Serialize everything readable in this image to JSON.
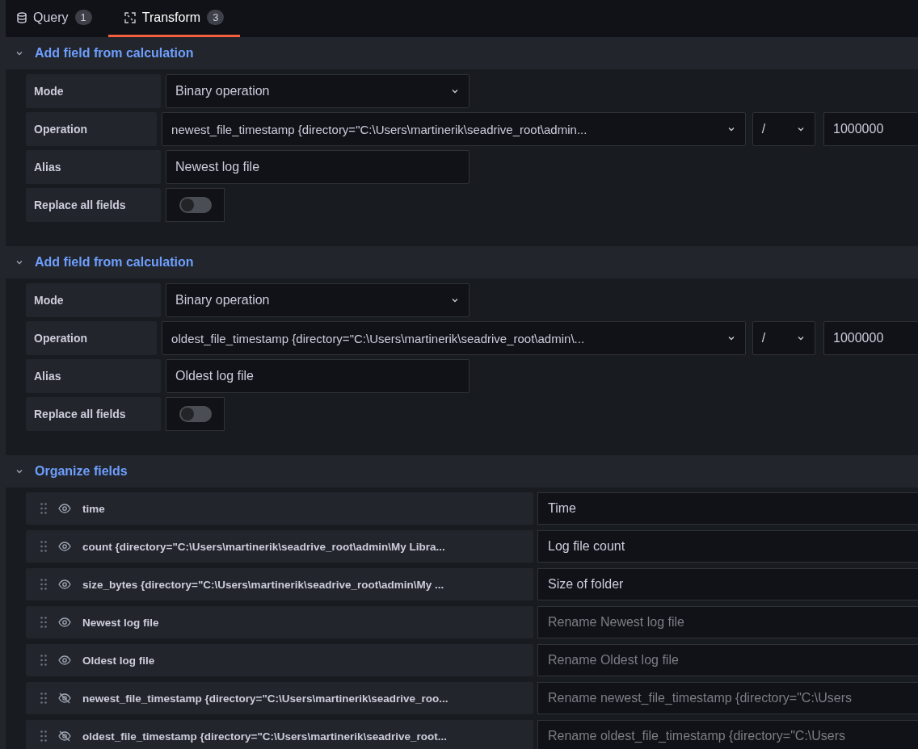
{
  "tabs": [
    {
      "label": "Query",
      "count": "1",
      "kind": "query",
      "selected": false
    },
    {
      "label": "Transform",
      "count": "3",
      "kind": "transform",
      "selected": true
    }
  ],
  "transformations": [
    {
      "kind": "calculation",
      "title": "Add field from calculation",
      "expanded": true,
      "mode_label": "Mode",
      "mode": "Binary operation",
      "operation_label": "Operation",
      "operand": "newest_file_timestamp {directory=\"C:\\Users\\martinerik\\seadrive_root\\admin...",
      "operator": "/",
      "value": "1000000",
      "alias_label": "Alias",
      "alias": "Newest log file",
      "replace_label": "Replace all fields",
      "replace_all": false
    },
    {
      "kind": "calculation",
      "title": "Add field from calculation",
      "expanded": true,
      "mode_label": "Mode",
      "mode": "Binary operation",
      "operation_label": "Operation",
      "operand": "oldest_file_timestamp {directory=\"C:\\Users\\martinerik\\seadrive_root\\admin\\...",
      "operator": "/",
      "value": "1000000",
      "alias_label": "Alias",
      "alias": "Oldest log file",
      "replace_label": "Replace all fields",
      "replace_all": false
    },
    {
      "kind": "organize",
      "title": "Organize fields",
      "expanded": true,
      "fields": [
        {
          "name": "time",
          "visible": true,
          "rename": "Time"
        },
        {
          "name": "count {directory=\"C:\\Users\\martinerik\\seadrive_root\\admin\\My Libra...",
          "visible": true,
          "rename": "Log file count"
        },
        {
          "name": "size_bytes {directory=\"C:\\Users\\martinerik\\seadrive_root\\admin\\My ...",
          "visible": true,
          "rename": "Size of folder"
        },
        {
          "name": "Newest log file",
          "visible": true,
          "placeholder": "Rename Newest log file"
        },
        {
          "name": "Oldest log file",
          "visible": true,
          "placeholder": "Rename Oldest log file"
        },
        {
          "name": "newest_file_timestamp {directory=\"C:\\Users\\martinerik\\seadrive_roo...",
          "visible": false,
          "placeholder": "Rename newest_file_timestamp {directory=\"C:\\Users"
        },
        {
          "name": "oldest_file_timestamp {directory=\"C:\\Users\\martinerik\\seadrive_root...",
          "visible": false,
          "placeholder": "Rename oldest_file_timestamp {directory=\"C:\\Users"
        }
      ]
    }
  ]
}
